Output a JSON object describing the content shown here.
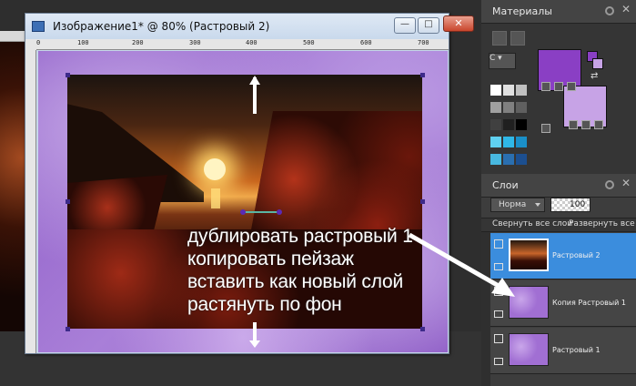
{
  "document_window": {
    "title": "Изображение1* @  80% (Растровый 2)",
    "ruler_marks": [
      "0",
      "100",
      "200",
      "300",
      "400",
      "500",
      "600",
      "700"
    ],
    "minimize_glyph": "—",
    "maximize_glyph": "□",
    "close_glyph": "✕"
  },
  "instructions": [
    "дублировать растровый 1",
    "копировать пейзаж",
    "вставить как новый слой",
    "растянуть по фон"
  ],
  "materials": {
    "title": "Материалы",
    "small_button": "C",
    "foreground_color": "#8a3fc4",
    "background_color": "#c7a3e6",
    "palette": [
      "#ffffff",
      "#e0e0e0",
      "#c0c0c0",
      "#a0a0a0",
      "#808080",
      "#606060",
      "#404040",
      "#202020",
      "#000000",
      "#5fd0f0",
      "#2fb8e8",
      "#1a8fc8",
      "#48b8e0",
      "#2a6fb0",
      "#1c4f90"
    ]
  },
  "layers": {
    "title": "Слои",
    "blend_mode": "Норма",
    "opacity": "100",
    "collapse_all": "Свернуть все слои",
    "expand_all": "Развернуть все с",
    "items": [
      {
        "name": "Растровый 2",
        "active": true
      },
      {
        "name": "Копия Растровый 1",
        "active": false
      },
      {
        "name": "Растровый 1",
        "active": false
      }
    ]
  },
  "colors": {
    "layer_highlight": "#3b8ddd",
    "panel_bg": "#3a3a3a"
  }
}
